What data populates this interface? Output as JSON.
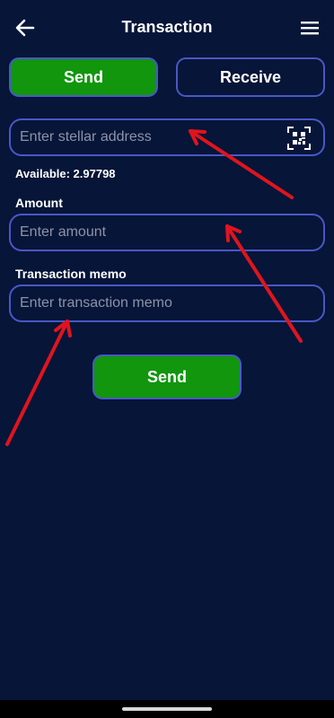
{
  "header": {
    "title": "Transaction",
    "back_icon": "arrow-left-icon",
    "menu_icon": "hamburger-menu-icon"
  },
  "tabs": {
    "send_label": "Send",
    "receive_label": "Receive",
    "active": "Send"
  },
  "address": {
    "placeholder": "Enter stellar address",
    "value": "",
    "scan_icon": "qr-scan-icon"
  },
  "balance": {
    "text": "Available: 2.97798"
  },
  "amount": {
    "label": "Amount",
    "placeholder": "Enter amount",
    "value": ""
  },
  "memo": {
    "label": "Transaction memo",
    "placeholder": "Enter transaction memo",
    "value": ""
  },
  "actions": {
    "send_label": "Send"
  },
  "colors": {
    "background": "#061538",
    "accent_green": "#11960e",
    "border_blue": "#4a57c7",
    "annotation_red": "#e0141e"
  }
}
